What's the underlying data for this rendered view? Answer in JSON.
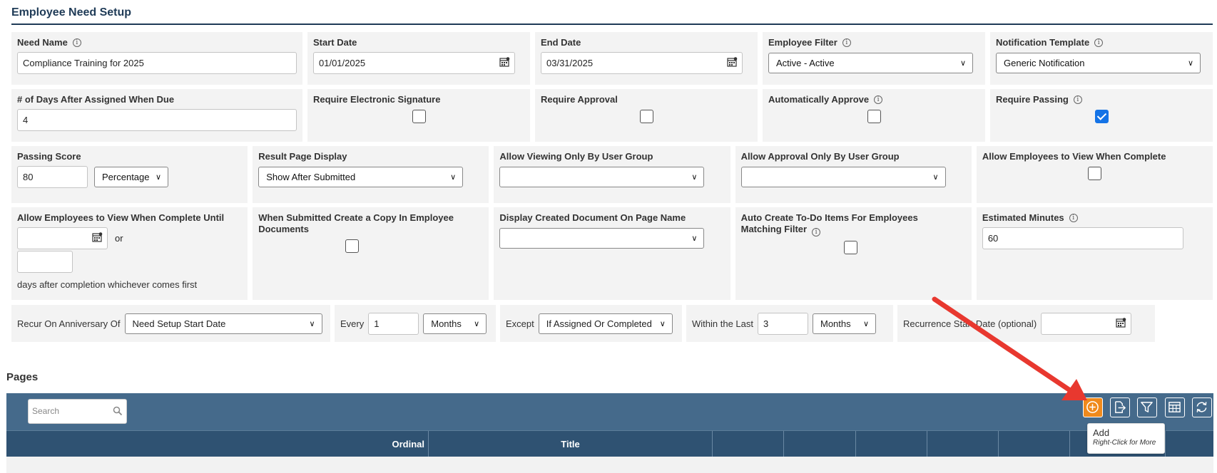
{
  "page": {
    "title": "Employee Need Setup"
  },
  "fields": {
    "need_name": {
      "label": "Need Name",
      "value": "Compliance Training for 2025"
    },
    "start_date": {
      "label": "Start Date",
      "value": "01/01/2025"
    },
    "end_date": {
      "label": "End Date",
      "value": "03/31/2025"
    },
    "employee_filter": {
      "label": "Employee Filter",
      "value": "Active - Active"
    },
    "notification_template": {
      "label": "Notification Template",
      "value": "Generic Notification"
    },
    "days_after_assigned": {
      "label": "# of Days After Assigned When Due",
      "value": "4"
    },
    "require_esig": {
      "label": "Require Electronic Signature",
      "checked": false
    },
    "require_approval": {
      "label": "Require Approval",
      "checked": false
    },
    "auto_approve": {
      "label": "Automatically Approve",
      "checked": false
    },
    "require_passing": {
      "label": "Require Passing",
      "checked": true
    },
    "passing_score": {
      "label": "Passing Score",
      "value": "80",
      "unit": "Percentage"
    },
    "result_page_display": {
      "label": "Result Page Display",
      "value": "Show After Submitted"
    },
    "allow_viewing_by_group": {
      "label": "Allow Viewing Only By User Group",
      "value": ""
    },
    "allow_approval_by_group": {
      "label": "Allow Approval Only By User Group",
      "value": ""
    },
    "allow_view_when_complete": {
      "label": "Allow Employees to View When Complete",
      "checked": false
    },
    "allow_view_until": {
      "label": "Allow Employees to View When Complete Until",
      "date_value": "",
      "or_text": "or",
      "days_value": "",
      "suffix": "days after completion whichever comes first"
    },
    "create_copy": {
      "label": "When Submitted Create a Copy In Employee Documents",
      "checked": false
    },
    "display_created_doc": {
      "label": "Display Created Document On Page Name",
      "value": ""
    },
    "auto_create_todo": {
      "label": "Auto Create To-Do Items For Employees Matching Filter",
      "checked": false
    },
    "estimated_minutes": {
      "label": "Estimated Minutes",
      "value": "60"
    }
  },
  "recurrence": {
    "anniversary_label": "Recur On Anniversary Of",
    "anniversary_value": "Need Setup Start Date",
    "every_label": "Every",
    "every_value": "1",
    "every_unit": "Months",
    "except_label": "Except",
    "except_value": "If Assigned Or Completed",
    "within_label": "Within the Last",
    "within_value": "3",
    "within_unit": "Months",
    "start_date_label": "Recurrence Start Date (optional)",
    "start_date_value": ""
  },
  "pages": {
    "title": "Pages",
    "search_placeholder": "Search",
    "columns": [
      "Ordinal",
      "Title"
    ],
    "tooltip": {
      "title": "Add",
      "hint": "Right-Click for More"
    }
  },
  "colors": {
    "accent": "#f08a1c",
    "toolbar": "#456a8b",
    "header": "#2f5272",
    "annotation_arrow": "#e8382f"
  }
}
